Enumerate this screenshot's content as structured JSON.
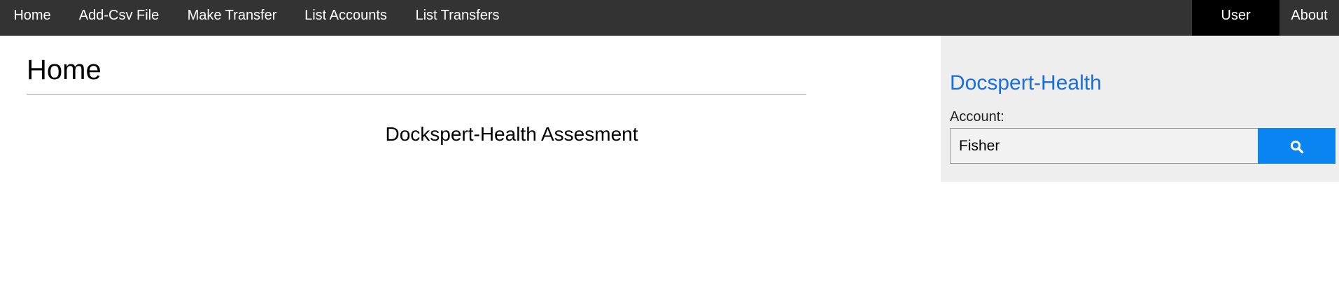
{
  "nav": {
    "items": [
      {
        "label": "Home"
      },
      {
        "label": "Add-Csv File"
      },
      {
        "label": "Make Transfer"
      },
      {
        "label": "List Accounts"
      },
      {
        "label": "List Transfers"
      }
    ],
    "user_label": "User",
    "about_label": "About"
  },
  "main": {
    "title": "Home",
    "subtitle": "Dockspert-Health Assesment"
  },
  "sidebar": {
    "brand": "Docspert-Health",
    "account_label": "Account:",
    "account_value": "Fisher",
    "search_icon": "search-icon"
  },
  "colors": {
    "nav_bg": "#333333",
    "nav_active": "#000000",
    "accent": "#0a84f0",
    "brand_link": "#1a6fdb",
    "panel_bg": "#eeeeee"
  }
}
